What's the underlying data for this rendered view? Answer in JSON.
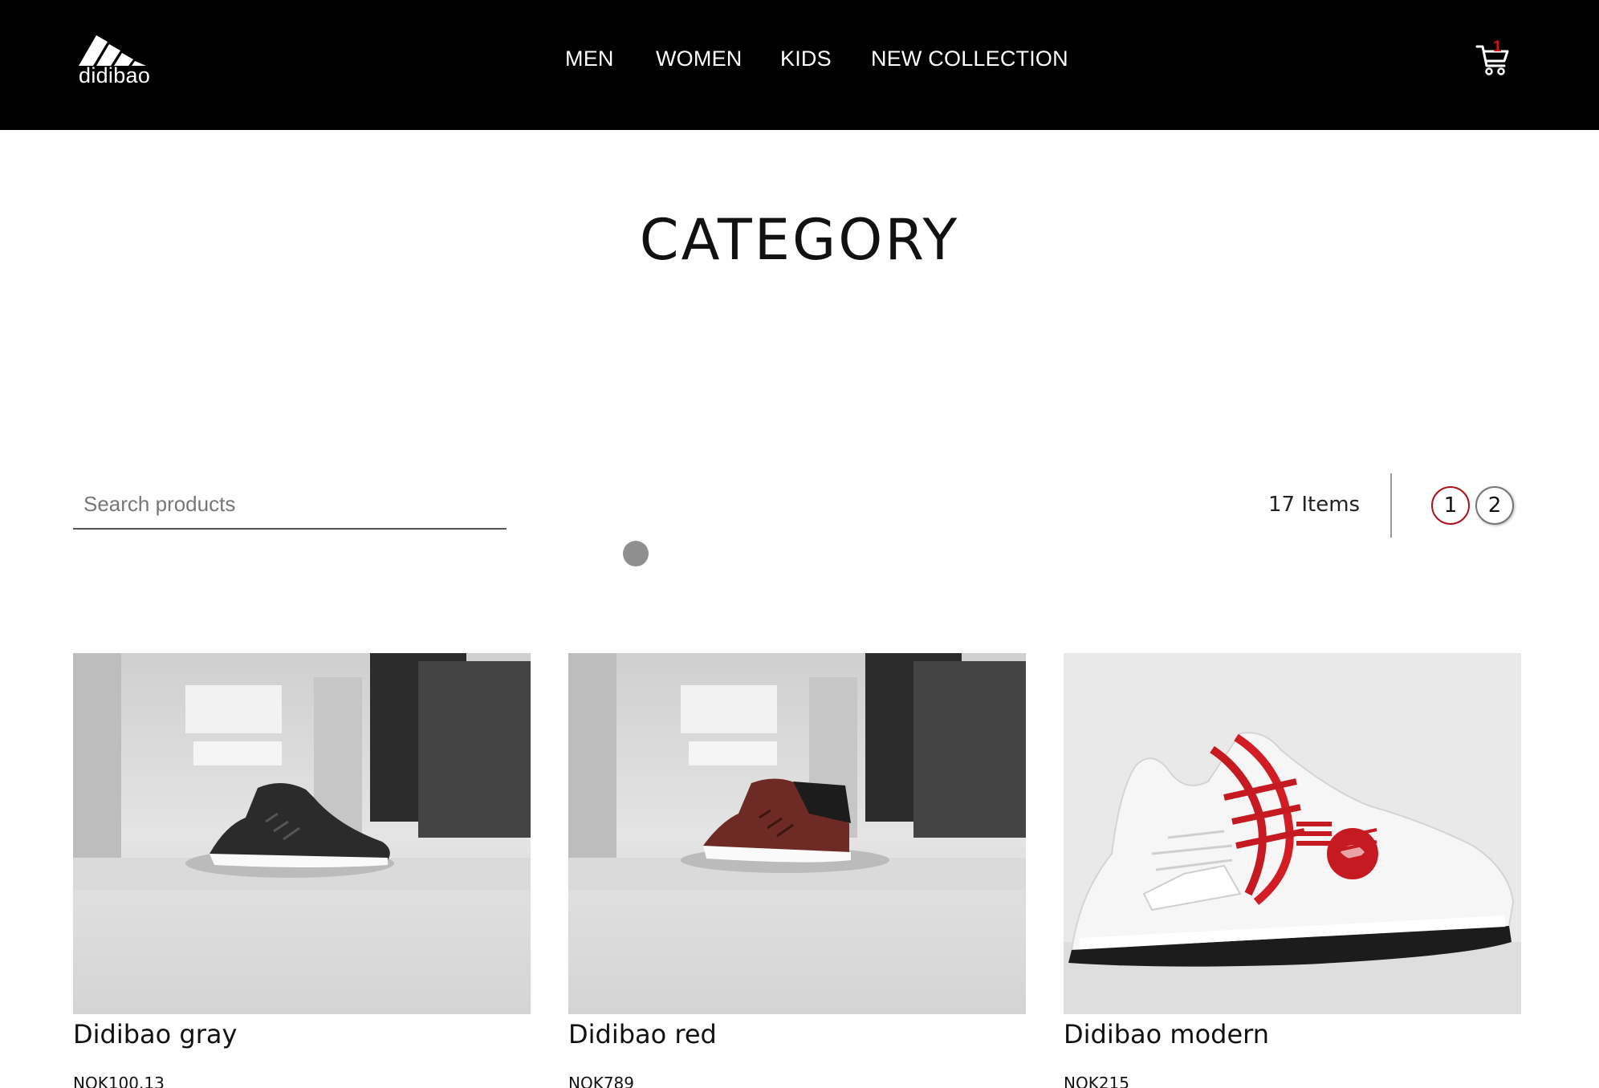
{
  "brand": {
    "logo_text": "didibao"
  },
  "nav": {
    "items": [
      {
        "label": "MEN"
      },
      {
        "label": "WOMEN"
      },
      {
        "label": "KIDS"
      },
      {
        "label": "NEW COLLECTION"
      }
    ]
  },
  "cart": {
    "icon": "cart-icon",
    "count": "1"
  },
  "page": {
    "title": "CATEGORY"
  },
  "search": {
    "placeholder": "Search products",
    "value": ""
  },
  "listing": {
    "items_count": "17 Items",
    "pages": [
      "1",
      "2"
    ],
    "current_page": "1"
  },
  "products": [
    {
      "name": "Didibao gray",
      "price": "NOK100.13",
      "image": "gray sneaker photo"
    },
    {
      "name": "Didibao red",
      "price": "NOK789",
      "image": "red sneaker photo"
    },
    {
      "name": "Didibao modern",
      "price": "NOK215",
      "image": "white and red sneaker photo"
    }
  ],
  "colors": {
    "header_bg": "#000000",
    "accent": "#b0121b",
    "text": "#111111"
  }
}
